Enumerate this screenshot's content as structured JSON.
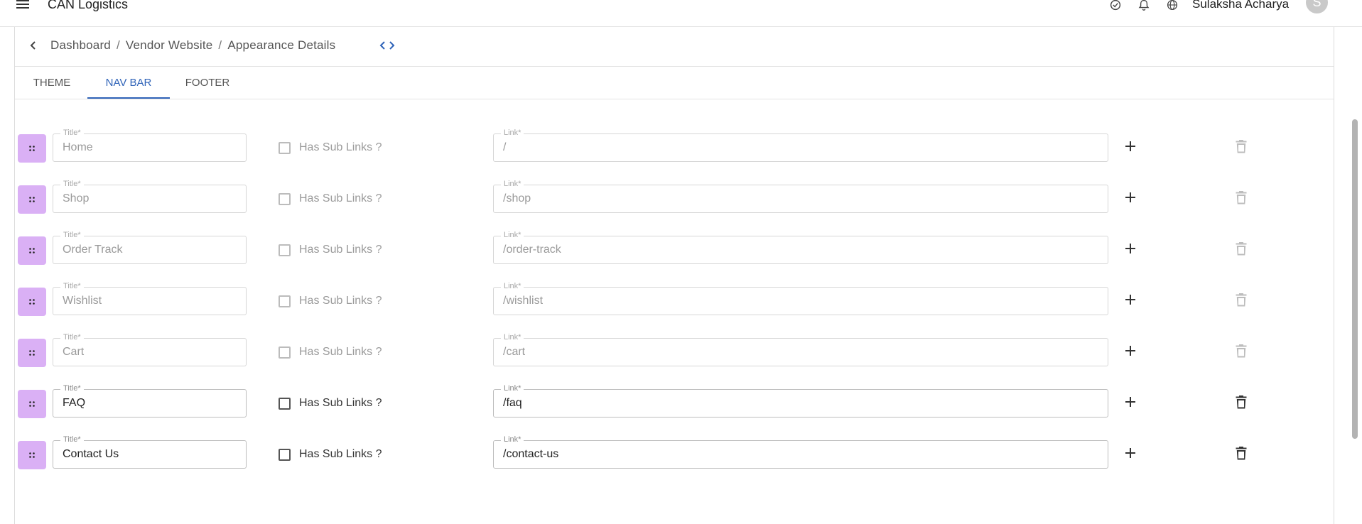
{
  "header": {
    "app_title": "CAN Logistics",
    "user_name": "Sulaksha Acharya",
    "avatar_letter": "S",
    "icons": [
      "menu-icon",
      "check-circle-icon",
      "bell-icon",
      "globe-icon"
    ]
  },
  "breadcrumb": {
    "items": [
      "Dashboard",
      "Vendor Website",
      "Appearance Details"
    ],
    "separator": "/"
  },
  "tabs": [
    {
      "label": "THEME",
      "active": false
    },
    {
      "label": "NAV BAR",
      "active": true
    },
    {
      "label": "FOOTER",
      "active": false
    }
  ],
  "labels": {
    "title_label": "Title*",
    "link_label": "Link*",
    "has_sub_links": "Has Sub Links ?"
  },
  "nav_rows": [
    {
      "title": "Home",
      "link": "/",
      "has_sub_links": false,
      "disabled": true
    },
    {
      "title": "Shop",
      "link": "/shop",
      "has_sub_links": false,
      "disabled": true
    },
    {
      "title": "Order Track",
      "link": "/order-track",
      "has_sub_links": false,
      "disabled": true
    },
    {
      "title": "Wishlist",
      "link": "/wishlist",
      "has_sub_links": false,
      "disabled": true
    },
    {
      "title": "Cart",
      "link": "/cart",
      "has_sub_links": false,
      "disabled": true
    },
    {
      "title": "FAQ",
      "link": "/faq",
      "has_sub_links": false,
      "disabled": false
    },
    {
      "title": "Contact Us",
      "link": "/contact-us",
      "has_sub_links": false,
      "disabled": false
    }
  ],
  "colors": {
    "accent": "#2f63b8",
    "handle_bg": "#dab0f5"
  }
}
